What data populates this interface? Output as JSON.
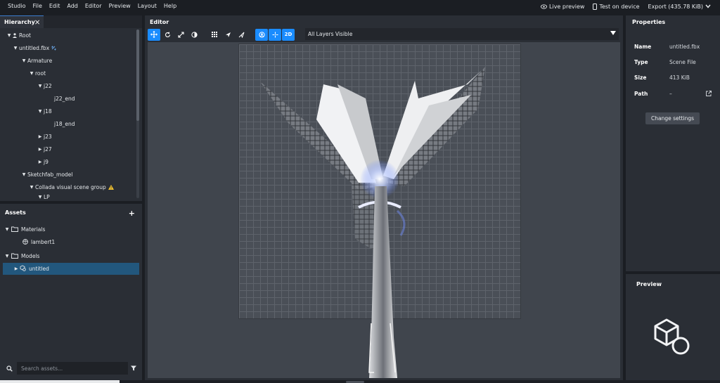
{
  "menubar": {
    "items": [
      "Studio",
      "File",
      "Edit",
      "Add",
      "Editor",
      "Preview",
      "Layout",
      "Help"
    ],
    "live_preview": "Live preview",
    "test_on_device": "Test on device",
    "export": "Export (435.78 KiB)"
  },
  "hierarchy": {
    "tab_label": "Hierarchy",
    "nodes": [
      {
        "label": "Root",
        "icon": "person-icon"
      },
      {
        "label": "untitled.fbx",
        "icon": "link-icon"
      },
      {
        "label": "Armature"
      },
      {
        "label": "root"
      },
      {
        "label": "j22"
      },
      {
        "label": "j22_end"
      },
      {
        "label": "j18"
      },
      {
        "label": "j18_end"
      },
      {
        "label": "j23"
      },
      {
        "label": "j27"
      },
      {
        "label": "j9"
      },
      {
        "label": "Sketchfab_model"
      },
      {
        "label": "Collada visual scene group",
        "icon": "warning-icon"
      },
      {
        "label": "LP"
      }
    ]
  },
  "assets": {
    "title": "Assets",
    "items": [
      {
        "label": "Materials",
        "icon": "folder-icon"
      },
      {
        "label": "lambert1",
        "icon": "material-icon"
      },
      {
        "label": "Models",
        "icon": "folder-icon"
      },
      {
        "label": "untitled",
        "icon": "model-icon"
      }
    ],
    "search_placeholder": "Search assets..."
  },
  "editor": {
    "title": "Editor",
    "mode_2d": "2D",
    "layers": "All Layers Visible"
  },
  "properties": {
    "title": "Properties",
    "rows": [
      {
        "key": "Name",
        "value": "untitled.fbx"
      },
      {
        "key": "Type",
        "value": "Scene File"
      },
      {
        "key": "Size",
        "value": "413 KiB"
      },
      {
        "key": "Path",
        "value": "–"
      }
    ],
    "change_settings": "Change settings"
  },
  "preview": {
    "title": "Preview"
  },
  "colors": {
    "accent": "#1a8cff",
    "selection": "#22577d",
    "warning": "#f2c22f"
  }
}
